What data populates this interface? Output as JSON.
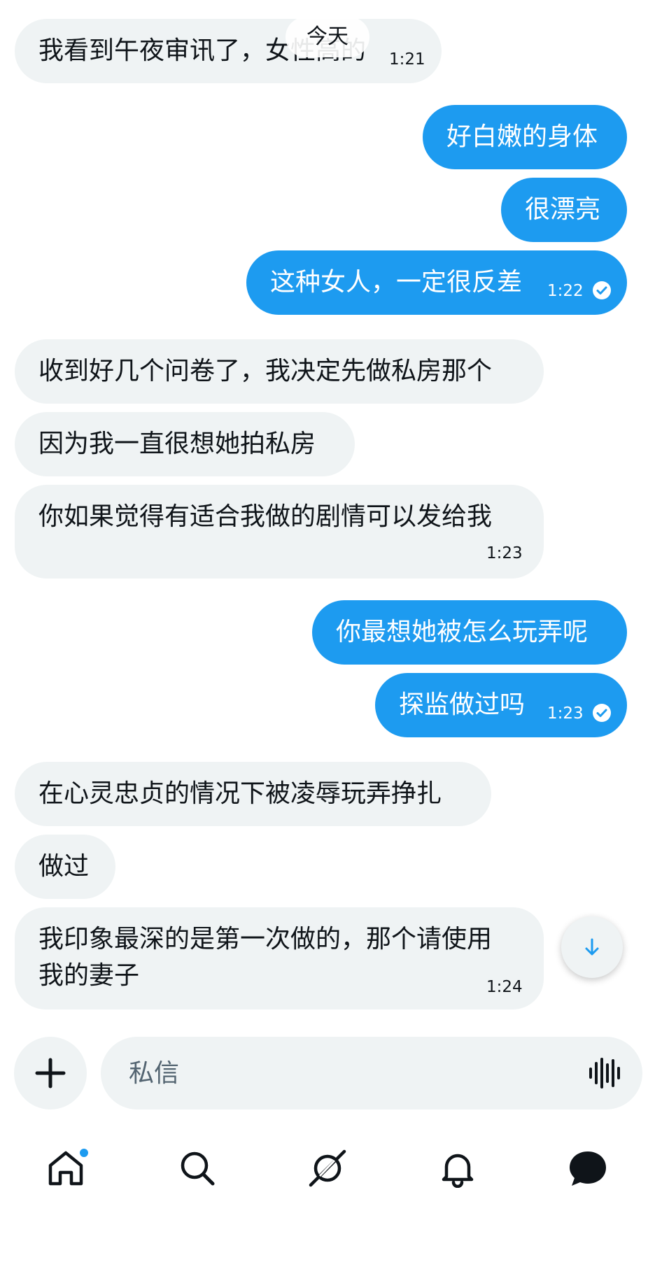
{
  "day_separator": "今天",
  "messages": [
    {
      "dir": "in",
      "text": "我看到午夜审讯了，女性高的",
      "time": "1:21"
    },
    {
      "dir": "out",
      "text": "好白嫩的身体"
    },
    {
      "dir": "out",
      "text": "很漂亮"
    },
    {
      "dir": "out",
      "text": "这种女人，一定很反差",
      "time": "1:22",
      "read": true
    },
    {
      "dir": "in",
      "text": "收到好几个问卷了，我决定先做私房那个"
    },
    {
      "dir": "in",
      "text": "因为我一直很想她拍私房"
    },
    {
      "dir": "in",
      "text": "你如果觉得有适合我做的剧情可以发给我",
      "time": "1:23"
    },
    {
      "dir": "out",
      "text": "你最想她被怎么玩弄呢"
    },
    {
      "dir": "out",
      "text": "探监做过吗",
      "time": "1:23",
      "read": true
    },
    {
      "dir": "in",
      "text": "在心灵忠贞的情况下被凌辱玩弄挣扎"
    },
    {
      "dir": "in",
      "text": "做过"
    },
    {
      "dir": "in",
      "text_line1": "我印象最深的是第一次做的，那个请使用",
      "text_line2": "我的妻子",
      "time": "1:24"
    }
  ],
  "composer": {
    "placeholder": "私信"
  },
  "icons": {
    "scroll": "arrow-down-icon",
    "add": "plus-icon",
    "voice": "voice-wave-icon",
    "tabs": [
      "home-icon",
      "search-icon",
      "grok-icon",
      "bell-icon",
      "messages-icon"
    ]
  },
  "colors": {
    "accent": "#1d9bf0",
    "incoming_bubble": "#eff3f4",
    "text": "#0f1419"
  }
}
